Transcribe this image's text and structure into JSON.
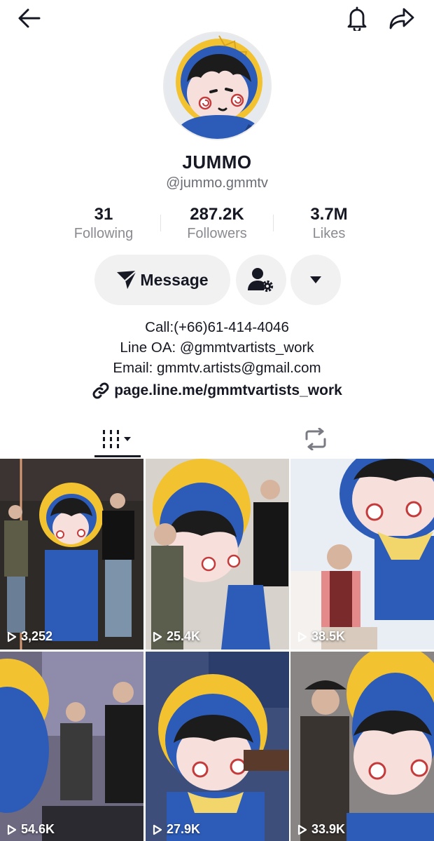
{
  "header": {
    "back_icon": "arrow-left-icon",
    "bell_icon": "bell-icon",
    "share_icon": "share-arrow-icon"
  },
  "profile": {
    "display_name": "JUMMO",
    "handle": "@jummo.gmmtv",
    "stats": [
      {
        "value": "31",
        "label": "Following"
      },
      {
        "value": "287.2K",
        "label": "Followers"
      },
      {
        "value": "3.7M",
        "label": "Likes"
      }
    ],
    "actions": {
      "message_label": "Message",
      "message_icon": "paper-plane-icon",
      "user_settings_icon": "user-gear-icon",
      "more_icon": "caret-down-icon"
    },
    "bio_lines": [
      "Call:(+66)61-414-4046",
      "Line OA: @gmmtvartists_work",
      "Email: gmmtv.artists@gmail.com"
    ],
    "link": "page.line.me/gmmtvartists_work"
  },
  "tabs": [
    {
      "name": "videos",
      "icon": "grid-bars-icon",
      "active": true
    },
    {
      "name": "reposts",
      "icon": "repost-icon",
      "active": false
    }
  ],
  "videos": [
    {
      "views": "3,252",
      "bg": "#3a3330",
      "accent": "#2d5cb8"
    },
    {
      "views": "25.4K",
      "bg": "#d8d4cf",
      "accent": "#2d5cb8"
    },
    {
      "views": "38.5K",
      "bg": "#eaeef4",
      "accent": "#2d5cb8"
    },
    {
      "views": "54.6K",
      "bg": "#6d6a83",
      "accent": "#2d5cb8"
    },
    {
      "views": "27.9K",
      "bg": "#3c4e79",
      "accent": "#2d5cb8"
    },
    {
      "views": "33.9K",
      "bg": "#8b8686",
      "accent": "#2d5cb8"
    }
  ],
  "colors": {
    "text": "#161823",
    "secondary": "#8a8b91",
    "pill_bg": "#f1f1f2",
    "mascot_blue": "#2d5cb8",
    "mascot_yellow": "#f2c230"
  }
}
